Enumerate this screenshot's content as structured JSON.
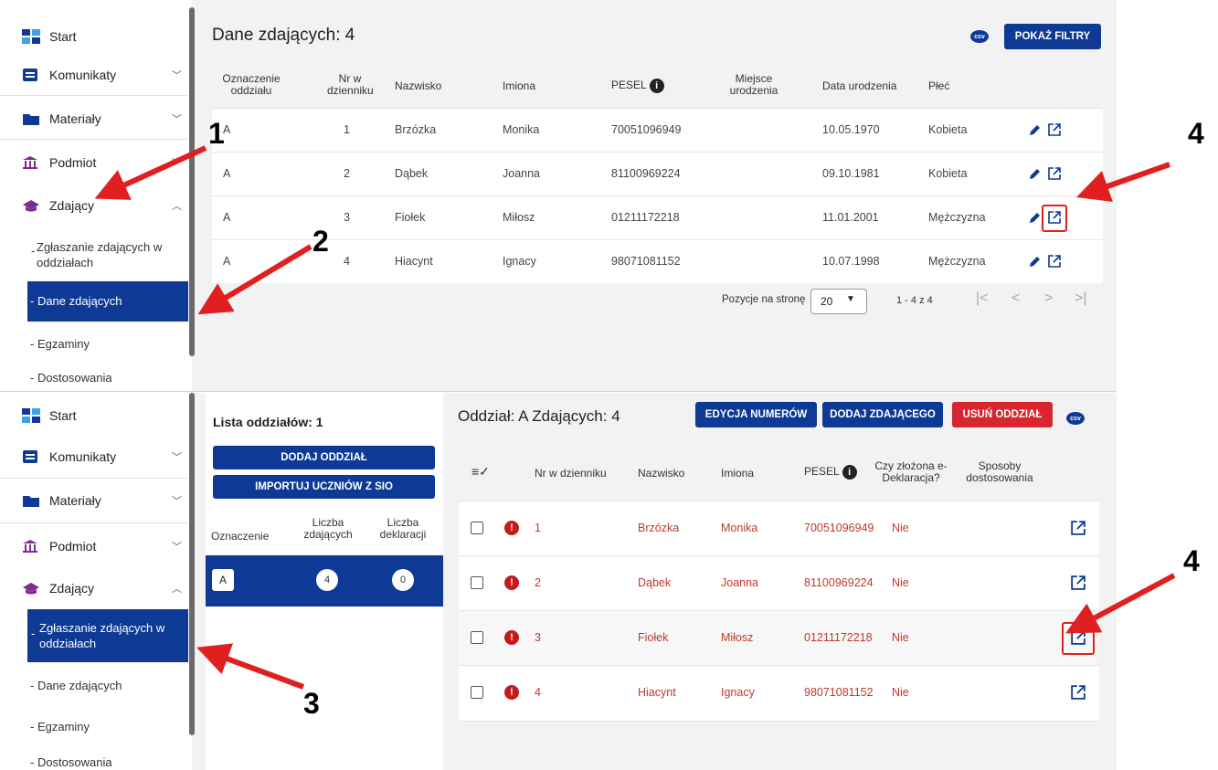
{
  "sidebar": {
    "start": "Start",
    "komunikaty": "Komunikaty",
    "materialy": "Materiały",
    "podmiot": "Podmiot",
    "zdajacy": "Zdający",
    "sub_zglaszanie": "Zgłaszanie zdających w oddziałach",
    "sub_dane": "- Dane zdających",
    "sub_egzaminy": "- Egzaminy",
    "sub_dostosowania": "- Dostosowania"
  },
  "top": {
    "title": "Dane zdających: 4",
    "csv_label": "csv",
    "filter_button": "POKAŻ FILTRY",
    "columns": [
      "Oznaczenie oddziału",
      "Nr w dzienniku",
      "Nazwisko",
      "Imiona",
      "PESEL",
      "Miejsce urodzenia",
      "Data urodzenia",
      "Płeć"
    ],
    "rows": [
      {
        "oddzial": "A",
        "nr": "1",
        "nazwisko": "Brzózka",
        "imiona": "Monika",
        "pesel": "70051096949",
        "data": "10.05.1970",
        "plec": "Kobieta"
      },
      {
        "oddzial": "A",
        "nr": "2",
        "nazwisko": "Dąbek",
        "imiona": "Joanna",
        "pesel": "81100969224",
        "data": "09.10.1981",
        "plec": "Kobieta"
      },
      {
        "oddzial": "A",
        "nr": "3",
        "nazwisko": "Fiołek",
        "imiona": "Miłosz",
        "pesel": "01211172218",
        "data": "11.01.2001",
        "plec": "Mężczyzna"
      },
      {
        "oddzial": "A",
        "nr": "4",
        "nazwisko": "Hiacynt",
        "imiona": "Ignacy",
        "pesel": "98071081152",
        "data": "10.07.1998",
        "plec": "Mężczyzna"
      }
    ],
    "pagination": {
      "label": "Pozycje na stronę",
      "per_page": "20",
      "range": "1 - 4 z 4"
    }
  },
  "bottom": {
    "list_title": "Lista oddziałów: 1",
    "add_class_button": "DODAJ ODDZIAŁ",
    "import_button": "IMPORTUJ UCZNIÓW Z SIO",
    "list_columns": [
      "Oznaczenie",
      "Liczba zdających",
      "Liczba deklaracji"
    ],
    "class_row": {
      "oznaczenie": "A",
      "zdajacych": "4",
      "deklaracji": "0"
    },
    "title": "Oddział: A Zdających: 4",
    "edit_numbers_button": "EDYCJA NUMERÓW",
    "add_student_button": "DODAJ ZDAJĄCEGO",
    "delete_class_button": "USUŃ ODDZIAŁ",
    "csv_label": "csv",
    "columns": [
      "Nr w dzienniku",
      "Nazwisko",
      "Imiona",
      "PESEL",
      "Czy złożona e-Deklaracja?",
      "Sposoby dostosowania"
    ],
    "rows": [
      {
        "nr": "1",
        "nazwisko": "Brzózka",
        "imiona": "Monika",
        "pesel": "70051096949",
        "deklaracja": "Nie"
      },
      {
        "nr": "2",
        "nazwisko": "Dąbek",
        "imiona": "Joanna",
        "pesel": "81100969224",
        "deklaracja": "Nie"
      },
      {
        "nr": "3",
        "nazwisko": "Fiołek",
        "imiona": "Miłosz",
        "pesel": "01211172218",
        "deklaracja": "Nie"
      },
      {
        "nr": "4",
        "nazwisko": "Hiacynt",
        "imiona": "Ignacy",
        "pesel": "98071081152",
        "deklaracja": "Nie"
      }
    ]
  },
  "annotations": {
    "n1": "1",
    "n2": "2",
    "n3": "3",
    "n4a": "4",
    "n4b": "4"
  },
  "colors": {
    "primary": "#0e3a96",
    "danger": "#d7262f",
    "arrow": "#e02020",
    "accent_purple": "#7a2f8e"
  }
}
